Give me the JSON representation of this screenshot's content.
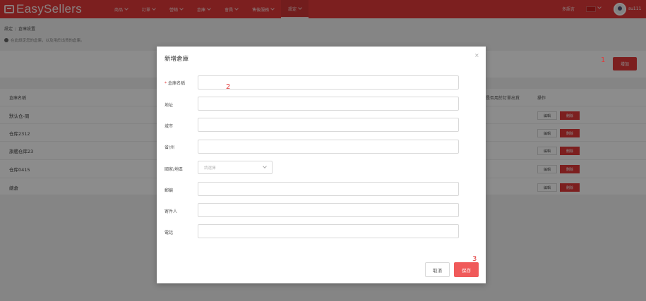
{
  "app": {
    "logo_text": "EasySellers"
  },
  "nav": {
    "items": [
      {
        "label": "商品"
      },
      {
        "label": "訂單"
      },
      {
        "label": "營銷"
      },
      {
        "label": "倉庫"
      },
      {
        "label": "會員"
      },
      {
        "label": "售後服務"
      },
      {
        "label": "設定"
      }
    ],
    "language_label": "多語言",
    "user_name": "su111"
  },
  "breadcrumb": {
    "root": "設定",
    "separator": "/",
    "current": "倉庫設置"
  },
  "tip": {
    "text": "在此設定您的倉庫，以及用於出貨的倉庫。"
  },
  "toolbar": {
    "add_label": "增加"
  },
  "annotations": {
    "mark1": "1",
    "mark2": "2",
    "mark3": "3"
  },
  "table": {
    "columns": {
      "name": "倉庫名稱",
      "default_order": "是否用於訂單出貨",
      "actions": "操作"
    },
    "rows": [
      {
        "name": "默认仓-周"
      },
      {
        "name": "仓库2312"
      },
      {
        "name": "旗艦仓库23"
      },
      {
        "name": "仓库0415"
      },
      {
        "name": "總倉"
      }
    ],
    "edit_label": "編輯",
    "delete_label": "刪除"
  },
  "modal": {
    "title": "新增倉庫",
    "close_glyph": "×",
    "fields": {
      "name": {
        "label": "倉庫名稱",
        "value": ""
      },
      "address": {
        "label": "地址",
        "value": ""
      },
      "city": {
        "label": "城市",
        "value": ""
      },
      "state": {
        "label": "省/州",
        "value": ""
      },
      "country": {
        "label": "國家/地區",
        "placeholder": "請選擇"
      },
      "zip": {
        "label": "郵編",
        "value": ""
      },
      "contact": {
        "label": "寄件人",
        "value": ""
      },
      "phone": {
        "label": "電話",
        "value": ""
      }
    },
    "cancel_label": "取消",
    "save_label": "保存"
  },
  "colors": {
    "brand": "#e23a3a",
    "save": "#f05a5a"
  }
}
